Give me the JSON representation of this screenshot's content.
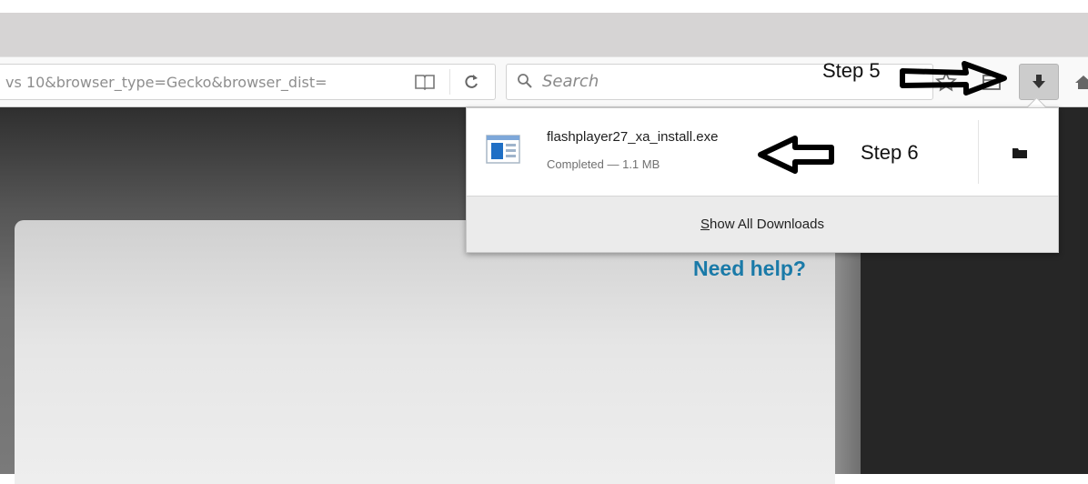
{
  "toolbar": {
    "url_text": "vs 10&browser_type=Gecko&browser_dist=",
    "search_placeholder": "Search"
  },
  "page": {
    "need_help": "Need help?"
  },
  "downloads_panel": {
    "file_name": "flashplayer27_xa_install.exe",
    "status": "Completed — 1.1 MB",
    "show_all_first_letter": "S",
    "show_all_rest": "how All Downloads"
  },
  "annotations": {
    "step5": "Step 5",
    "step6": "Step 6"
  },
  "icons": {
    "reader": "reader-view-icon",
    "reload": "reload-icon",
    "search": "search-icon",
    "bookmark": "star-icon",
    "library": "library-icon",
    "download": "download-arrow-icon",
    "home": "home-icon",
    "file": "installer-file-icon",
    "folder": "folder-icon"
  },
  "colors": {
    "link": "#1a7aa8",
    "download_button_active": "#cccccc"
  }
}
